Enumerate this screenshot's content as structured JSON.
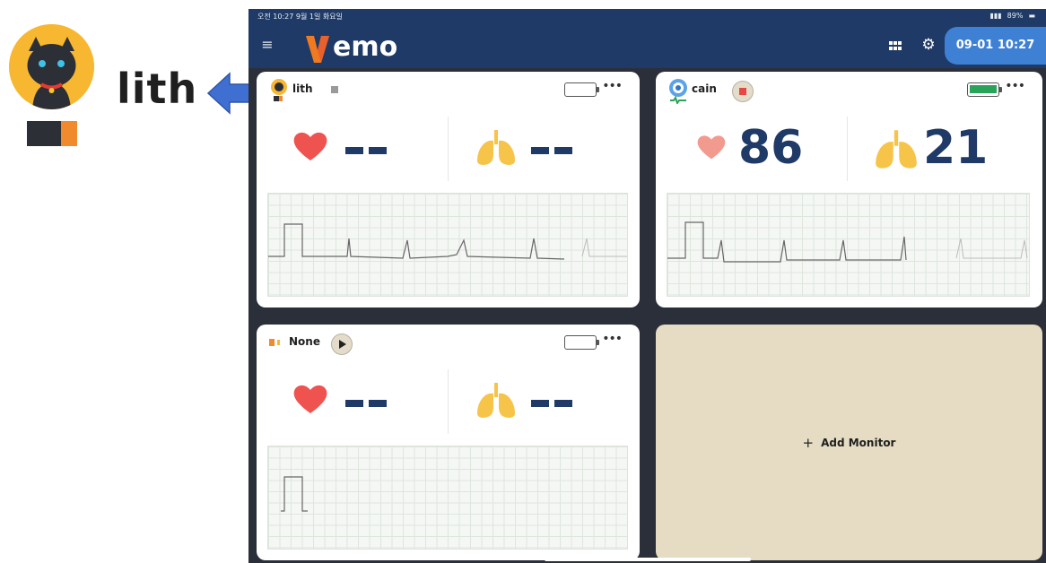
{
  "callout": {
    "name": "lith"
  },
  "status_bar": {
    "left_text": "오전 10:27  9월 1일 화요일",
    "battery_text": "89%"
  },
  "header": {
    "logo_text": "emo",
    "clock": "09-01 10:27"
  },
  "monitors": [
    {
      "name": "lith",
      "heart_rate": "",
      "resp_rate": "",
      "status": "stopped"
    },
    {
      "name": "cain",
      "heart_rate": "86",
      "resp_rate": "21",
      "status": "recording",
      "battery_level": 1.0
    },
    {
      "name": "None",
      "heart_rate": "",
      "resp_rate": "",
      "status": "paused"
    }
  ],
  "add_monitor": {
    "label": "Add Monitor"
  },
  "colors": {
    "header_bg": "#1f3a66",
    "accent_blue": "#3e80d4",
    "logo_orange": "#f07a20",
    "heart": "#ef5350",
    "lungs": "#f7c44a",
    "add_card": "#e5dcc3",
    "battery_green": "#29a35a"
  },
  "icons": {
    "menu": "hamburger-icon",
    "grid": "grid-icon",
    "settings": "gear-icon",
    "heart": "heart-icon",
    "lungs": "lungs-icon",
    "more": "more-horizontal-icon",
    "battery": "battery-icon",
    "play": "play-icon",
    "stop": "stop-icon",
    "plus": "plus-icon"
  }
}
